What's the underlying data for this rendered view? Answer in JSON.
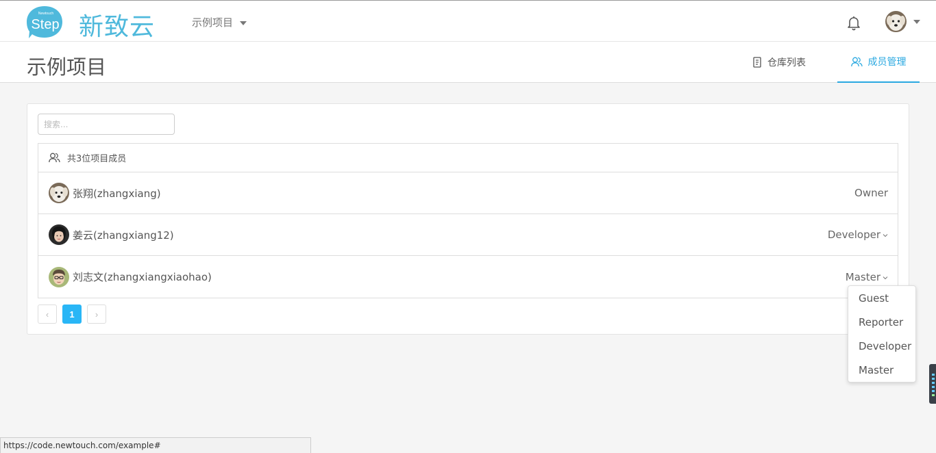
{
  "header": {
    "logo_text": "Step",
    "logo_subtext": "Newtouch",
    "brand": "新致云",
    "project_selector": "示例项目"
  },
  "subheader": {
    "title": "示例项目",
    "tabs": [
      {
        "label": "仓库列表",
        "active": false
      },
      {
        "label": "成员管理",
        "active": true
      }
    ]
  },
  "search": {
    "placeholder": "搜索..."
  },
  "members": {
    "summary": "共3位项目成员",
    "rows": [
      {
        "name": "张翔(zhangxiang)",
        "role": "Owner"
      },
      {
        "name": "姜云(zhangxiang12)",
        "role": "Developer"
      },
      {
        "name": "刘志文(zhangxiangxiaohao)",
        "role": "Master"
      }
    ]
  },
  "pagination": {
    "prev": "‹",
    "current": "1",
    "next": "›"
  },
  "role_dropdown": {
    "options": [
      "Guest",
      "Reporter",
      "Developer",
      "Master"
    ]
  },
  "status_bar": {
    "url": "https://code.newtouch.com/example#"
  },
  "colors": {
    "accent": "#29a8e0",
    "brand": "#4fb9dc"
  }
}
